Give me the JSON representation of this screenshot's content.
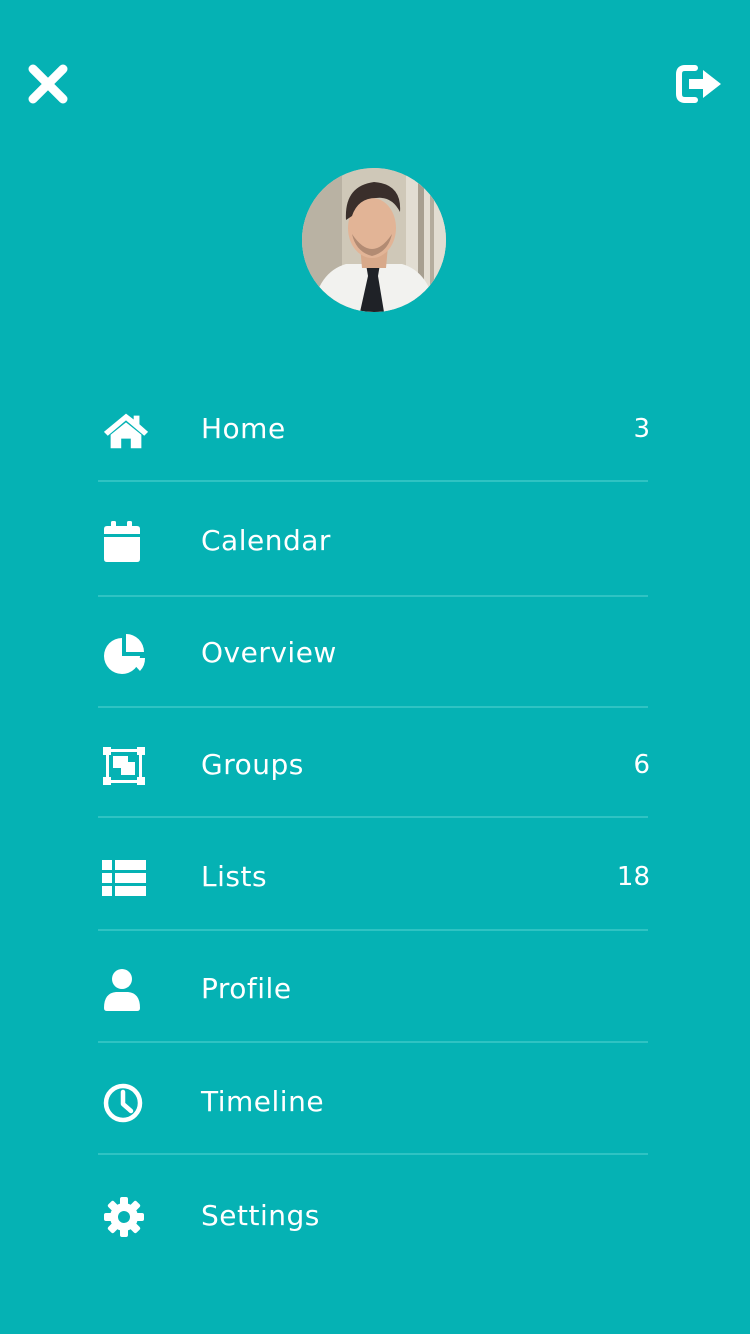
{
  "colors": {
    "background": "#05b2b4",
    "divider": "#2fc3c3",
    "foreground": "#ffffff"
  },
  "header": {
    "close_icon": "close-icon",
    "logout_icon": "logout-icon"
  },
  "profile": {
    "avatar": "avatar-photo"
  },
  "menu": {
    "items": [
      {
        "label": "Home",
        "icon": "home-icon",
        "count": "3"
      },
      {
        "label": "Calendar",
        "icon": "calendar-icon",
        "count": ""
      },
      {
        "label": "Overview",
        "icon": "pie-chart-icon",
        "count": ""
      },
      {
        "label": "Groups",
        "icon": "object-group-icon",
        "count": "6"
      },
      {
        "label": "Lists",
        "icon": "list-icon",
        "count": "18"
      },
      {
        "label": "Profile",
        "icon": "user-icon",
        "count": ""
      },
      {
        "label": "Timeline",
        "icon": "clock-icon",
        "count": ""
      },
      {
        "label": "Settings",
        "icon": "gear-icon",
        "count": ""
      }
    ]
  }
}
